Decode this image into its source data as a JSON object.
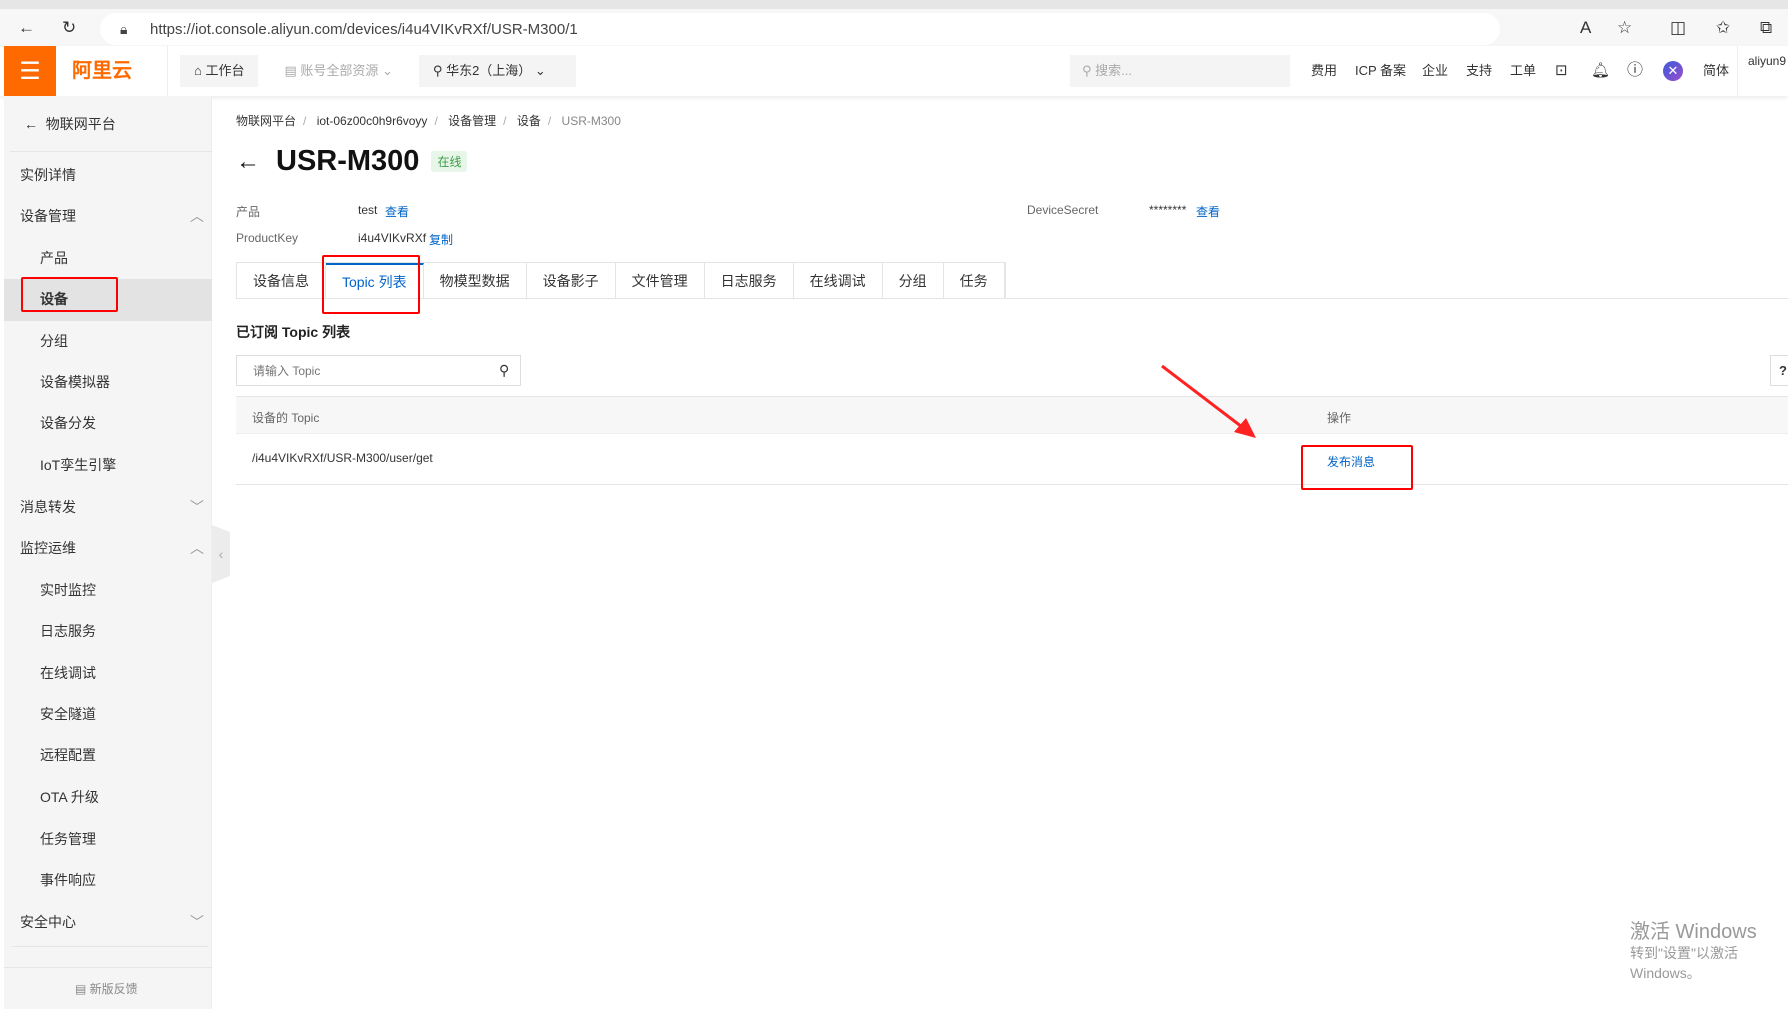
{
  "browser": {
    "url": "https://iot.console.aliyun.com/devices/i4u4VIKvRXf/USR-M300/1"
  },
  "header": {
    "logo": "阿里云",
    "workbench": "工作台",
    "resources": "账号全部资源",
    "region": "华东2（上海）",
    "search_placeholder": "搜索...",
    "links": [
      "费用",
      "ICP 备案",
      "企业",
      "支持",
      "工单"
    ],
    "lang": "简体",
    "user": "aliyun9"
  },
  "sidebar": {
    "back": "物联网平台",
    "items": [
      {
        "label": "实例详情",
        "level": 1
      },
      {
        "label": "设备管理",
        "level": 1,
        "chev": "up"
      },
      {
        "label": "产品",
        "level": 2
      },
      {
        "label": "设备",
        "level": 2,
        "selected": true
      },
      {
        "label": "分组",
        "level": 2
      },
      {
        "label": "设备模拟器",
        "level": 2
      },
      {
        "label": "设备分发",
        "level": 2
      },
      {
        "label": "IoT孪生引擎",
        "level": 2
      },
      {
        "label": "消息转发",
        "level": 1,
        "chev": "down"
      },
      {
        "label": "监控运维",
        "level": 1,
        "chev": "up"
      },
      {
        "label": "实时监控",
        "level": 2
      },
      {
        "label": "日志服务",
        "level": 2
      },
      {
        "label": "在线调试",
        "level": 2
      },
      {
        "label": "安全隧道",
        "level": 2
      },
      {
        "label": "远程配置",
        "level": 2
      },
      {
        "label": "OTA 升级",
        "level": 2
      },
      {
        "label": "任务管理",
        "level": 2
      },
      {
        "label": "事件响应",
        "level": 2
      },
      {
        "label": "安全中心",
        "level": 1,
        "chev": "down"
      }
    ],
    "feedback": "新版反馈"
  },
  "breadcrumb": [
    "物联网平台",
    "iot-06z00c0h9r6voyy",
    "设备管理",
    "设备",
    "USR-M300"
  ],
  "device": {
    "name": "USR-M300",
    "status": "在线",
    "product_label": "产品",
    "product": "test",
    "view": "查看",
    "productkey_label": "ProductKey",
    "productkey": "i4u4VIKvRXf",
    "copy": "复制",
    "secret_label": "DeviceSecret",
    "secret": "********",
    "secret_view": "查看"
  },
  "tabs": [
    "设备信息",
    "Topic 列表",
    "物模型数据",
    "设备影子",
    "文件管理",
    "日志服务",
    "在线调试",
    "分组",
    "任务"
  ],
  "topic": {
    "title": "已订阅 Topic 列表",
    "search_placeholder": "请输入 Topic",
    "col_topic": "设备的 Topic",
    "col_action": "操作",
    "rows": [
      {
        "topic": "/i4u4VIKvRXf/USR-M300/user/get",
        "action": "发布消息"
      }
    ]
  },
  "watermark": {
    "line1": "激活 Windows",
    "line2": "转到\"设置\"以激活 Windows。"
  }
}
